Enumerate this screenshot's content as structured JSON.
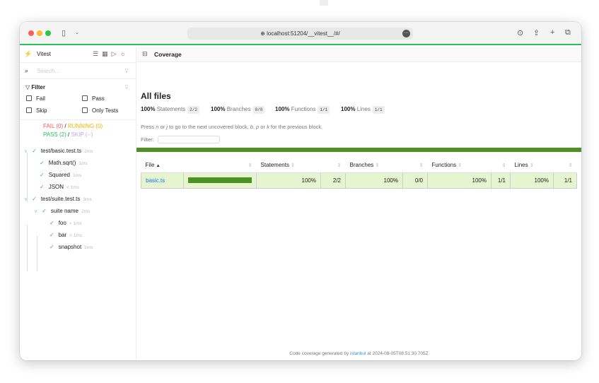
{
  "browser": {
    "url": "localhost:51204/__vitest__/#/",
    "colors": {
      "close": "#fe5f57",
      "minimize": "#febc2e",
      "maximize": "#28c840"
    }
  },
  "sidebar": {
    "app_name": "Vitest",
    "search_placeholder": "Search...",
    "filter_label": "Filter",
    "filters": [
      {
        "label": "Fail",
        "checked": false
      },
      {
        "label": "Pass",
        "checked": false
      },
      {
        "label": "Skip",
        "checked": false
      },
      {
        "label": "Only Tests",
        "checked": false
      }
    ],
    "summary": {
      "fail": "FAIL (0)",
      "running": "RUNNING (0)",
      "pass": "PASS (2)",
      "skip": "SKIP (--)",
      "sep": "/"
    },
    "tests": [
      {
        "name": "test/basic.test.ts",
        "duration": "2ms",
        "level": 0,
        "expandable": true
      },
      {
        "name": "Math.sqrt()",
        "duration": "1ms",
        "level": 1
      },
      {
        "name": "Squared",
        "duration": "1ms",
        "level": 1
      },
      {
        "name": "JSON",
        "duration": "< 1ms",
        "level": 1
      },
      {
        "name": "test/suite.test.ts",
        "duration": "3ms",
        "level": 0,
        "expandable": true
      },
      {
        "name": "suite name",
        "duration": "2ms",
        "level": 1,
        "expandable": true
      },
      {
        "name": "foo",
        "duration": "< 1ms",
        "level": 2
      },
      {
        "name": "bar",
        "duration": "< 1ms",
        "level": 2
      },
      {
        "name": "snapshot",
        "duration": "1ms",
        "level": 2
      }
    ]
  },
  "main": {
    "tab": "Coverage",
    "title": "All files",
    "stats": [
      {
        "pct": "100%",
        "label": "Statements",
        "frac": "2/2"
      },
      {
        "pct": "100%",
        "label": "Branches",
        "frac": "0/0"
      },
      {
        "pct": "100%",
        "label": "Functions",
        "frac": "1/1"
      },
      {
        "pct": "100%",
        "label": "Lines",
        "frac": "1/1"
      }
    ],
    "hint": {
      "a": "Press ",
      "n": "n",
      "b": " or ",
      "j": "j",
      "c": " to go to the next uncovered block, ",
      "bb": "b",
      "d": ", ",
      "p": "p",
      "e": " or ",
      "k": "k",
      "f": " for the previous block."
    },
    "filter_label": "Filter:",
    "columns": [
      "File",
      "",
      "Statements",
      "",
      "Branches",
      "",
      "Functions",
      "",
      "Lines",
      ""
    ],
    "rows": [
      {
        "file": "basic.ts",
        "coverage": 100,
        "statements": "100%",
        "statements_frac": "2/2",
        "branches": "100%",
        "branches_frac": "0/0",
        "functions": "100%",
        "functions_frac": "1/1",
        "lines": "100%",
        "lines_frac": "1/1"
      }
    ],
    "footer": {
      "a": "Code coverage generated by ",
      "link": "istanbul",
      "b": " at 2024-08-05T08:51:30.705Z"
    },
    "colors": {
      "bar": "#4d9221",
      "row": "#e6f5d0"
    }
  }
}
